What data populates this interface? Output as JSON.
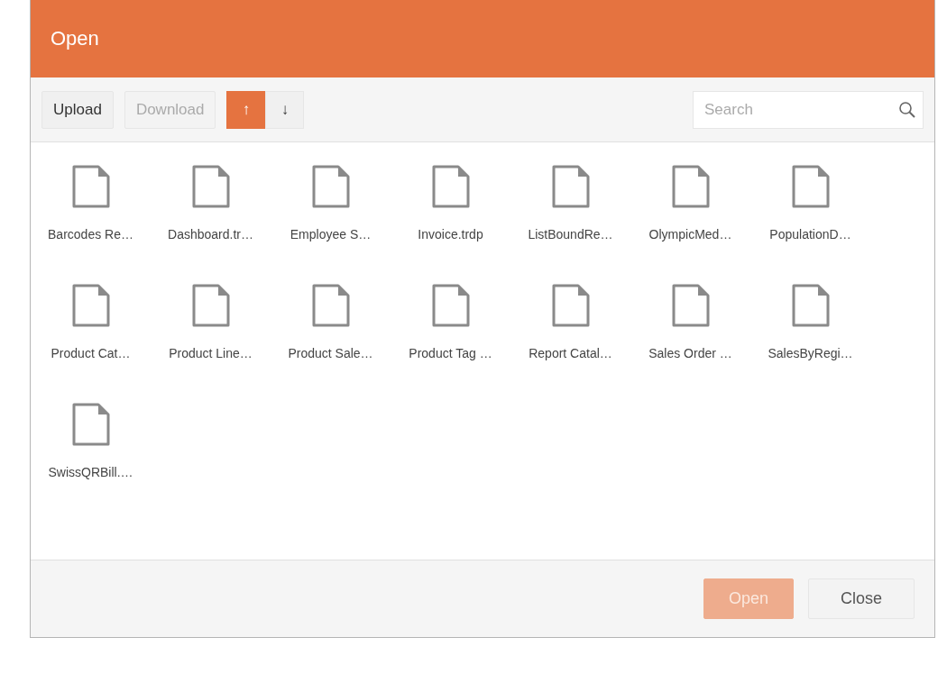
{
  "dialog": {
    "title": "Open"
  },
  "toolbar": {
    "buttons": [
      {
        "label": "Upload",
        "disabled": false
      },
      {
        "label": "Download",
        "disabled": true
      }
    ],
    "sort": [
      {
        "label": "↑",
        "selected": true
      },
      {
        "label": "↓",
        "selected": false
      }
    ],
    "search": {
      "placeholder": "Search"
    }
  },
  "files": [
    {
      "name": "Barcodes Re…"
    },
    {
      "name": "Dashboard.tr…"
    },
    {
      "name": "Employee S…"
    },
    {
      "name": "Invoice.trdp"
    },
    {
      "name": "ListBoundRe…"
    },
    {
      "name": "OlympicMed…"
    },
    {
      "name": "PopulationD…"
    },
    {
      "name": "Product Cat…"
    },
    {
      "name": "Product Line…"
    },
    {
      "name": "Product Sale…"
    },
    {
      "name": "Product Tag …"
    },
    {
      "name": "Report Catal…"
    },
    {
      "name": "Sales Order …"
    },
    {
      "name": "SalesByRegi…"
    },
    {
      "name": "SwissQRBill.…"
    }
  ],
  "footer": {
    "buttons": [
      {
        "label": "Open",
        "kind": "primary",
        "disabled": true
      },
      {
        "label": "Close",
        "kind": "secondary",
        "disabled": false
      }
    ]
  }
}
